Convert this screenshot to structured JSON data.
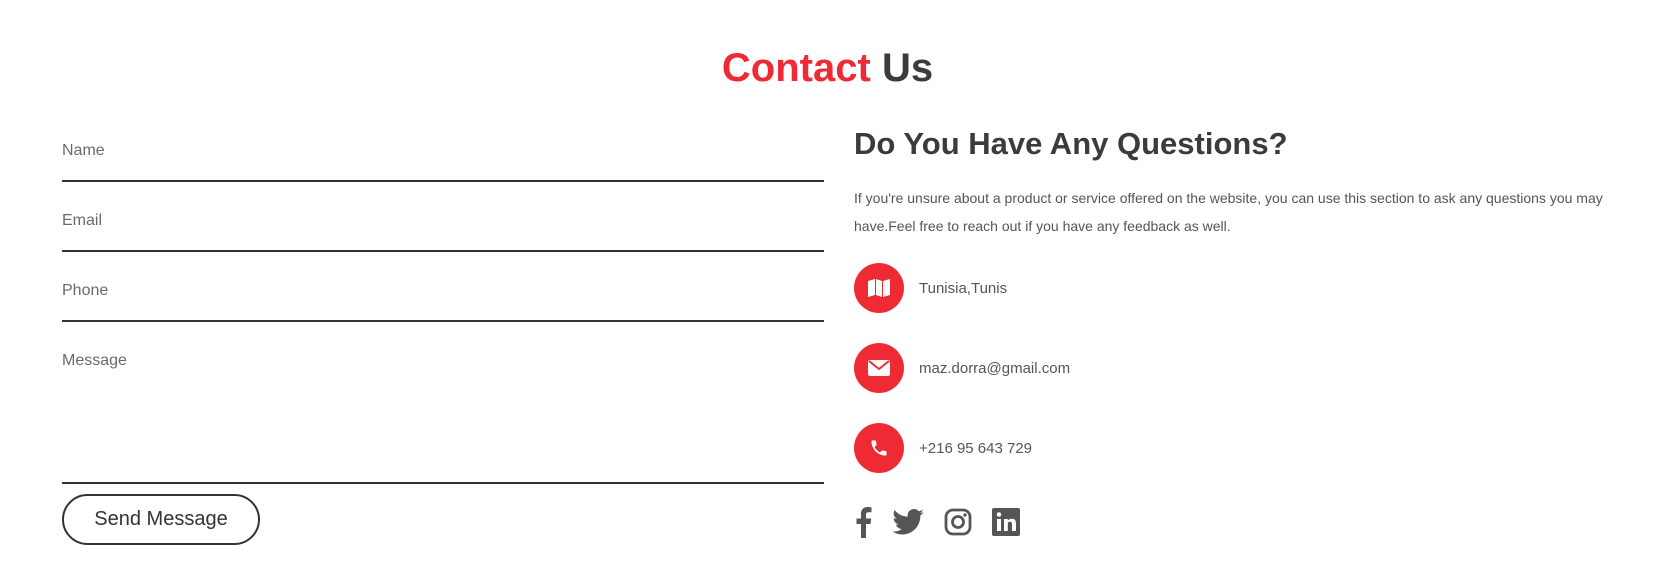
{
  "heading": {
    "accent": "Contact",
    "rest": "Us"
  },
  "form": {
    "name_placeholder": "Name",
    "email_placeholder": "Email",
    "phone_placeholder": "Phone",
    "message_placeholder": "Message",
    "send_label": "Send Message"
  },
  "info": {
    "title": "Do You Have Any Questions?",
    "description": "If you're unsure about a product or service offered on the website, you can use this section to ask any questions you may have.Feel free to reach out if you have any feedback as well.",
    "items": [
      {
        "icon": "map-icon",
        "text": "Tunisia,Tunis"
      },
      {
        "icon": "envelope-icon",
        "text": "maz.dorra@gmail.com"
      },
      {
        "icon": "phone-icon",
        "text": "+216 95 643 729"
      }
    ]
  },
  "socials": [
    "facebook-icon",
    "twitter-icon",
    "instagram-icon",
    "linkedin-icon"
  ],
  "colors": {
    "accent": "#ee2a35",
    "text": "#3b3b3b",
    "icon": "#555555"
  }
}
